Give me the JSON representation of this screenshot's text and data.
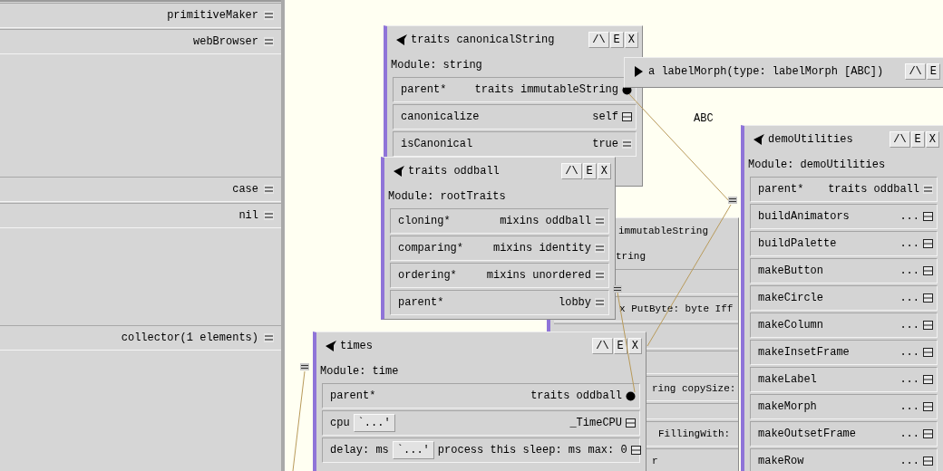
{
  "side_panel": {
    "rows": [
      {
        "label": "primitiveMaker",
        "kind": "data"
      },
      {
        "label": "webBrowser",
        "kind": "data"
      },
      {
        "label": "case",
        "kind": "data"
      },
      {
        "label": "nil",
        "kind": "data"
      },
      {
        "label": "collector(1 elements)",
        "kind": "data"
      }
    ]
  },
  "canvas_label": "ABC",
  "outliners": [
    {
      "title": "traits canonicalString",
      "expanded": true,
      "buttons": [
        "/\\",
        "E",
        "X"
      ],
      "module": "Module: string",
      "slots": [
        {
          "name": "parent*",
          "value": "traits immutableString",
          "kind": "dot"
        },
        {
          "name": "canonicalize",
          "value": "self",
          "kind": "method"
        },
        {
          "name": "isCanonical",
          "value": "true",
          "kind": "data"
        }
      ]
    },
    {
      "title": "a labelMorph(type: labelMorph [ABC])",
      "expanded": false,
      "buttons": [
        "/\\",
        "E"
      ]
    },
    {
      "title": "demoUtilities",
      "expanded": true,
      "buttons": [
        "/\\",
        "E",
        "X"
      ],
      "module": "Module: demoUtilities",
      "slots": [
        {
          "name": "parent*",
          "value": "traits oddball",
          "kind": "data"
        },
        {
          "name": "buildAnimators",
          "value": "...",
          "kind": "method"
        },
        {
          "name": "buildPalette",
          "value": "...",
          "kind": "method"
        },
        {
          "name": "makeButton",
          "value": "...",
          "kind": "method"
        },
        {
          "name": "makeCircle",
          "value": "...",
          "kind": "method"
        },
        {
          "name": "makeColumn",
          "value": "...",
          "kind": "method"
        },
        {
          "name": "makeInsetFrame",
          "value": "...",
          "kind": "method"
        },
        {
          "name": "makeLabel",
          "value": "...",
          "kind": "method"
        },
        {
          "name": "makeMorph",
          "value": "...",
          "kind": "method"
        },
        {
          "name": "makeOutsetFrame",
          "value": "...",
          "kind": "method"
        },
        {
          "name": "makeRow",
          "value": "...",
          "kind": "method"
        }
      ]
    },
    {
      "title": "traits oddball",
      "expanded": true,
      "buttons": [
        "/\\",
        "E",
        "X"
      ],
      "module": "Module: rootTraits",
      "slots": [
        {
          "name": "cloning*",
          "value": "mixins oddball",
          "kind": "data"
        },
        {
          "name": "comparing*",
          "value": "mixins identity",
          "kind": "data"
        },
        {
          "name": "ordering*",
          "value": "mixins unordered",
          "kind": "data"
        },
        {
          "name": "parent*",
          "value": "lobby",
          "kind": "data"
        }
      ]
    },
    {
      "kind": "covered",
      "title": "immutableString",
      "module": "tring",
      "slots": [
        {
          "name": "x PutByte: byte Iff"
        },
        {
          "name": "ring copySize:"
        },
        {
          "name": "FillingWith:"
        },
        {
          "name": "r"
        }
      ]
    },
    {
      "title": "times",
      "expanded": true,
      "buttons": [
        "/\\",
        "E",
        "X"
      ],
      "module": "Module: time",
      "slots": [
        {
          "name": "parent*",
          "value": "traits oddball",
          "kind": "dot"
        },
        {
          "name": "cpu",
          "button": "`...'",
          "value": "_TimeCPU",
          "kind": "method"
        },
        {
          "name": "delay: ms",
          "button": "`...'",
          "value": "process this sleep: ms max: 0",
          "kind": "method"
        }
      ]
    }
  ]
}
